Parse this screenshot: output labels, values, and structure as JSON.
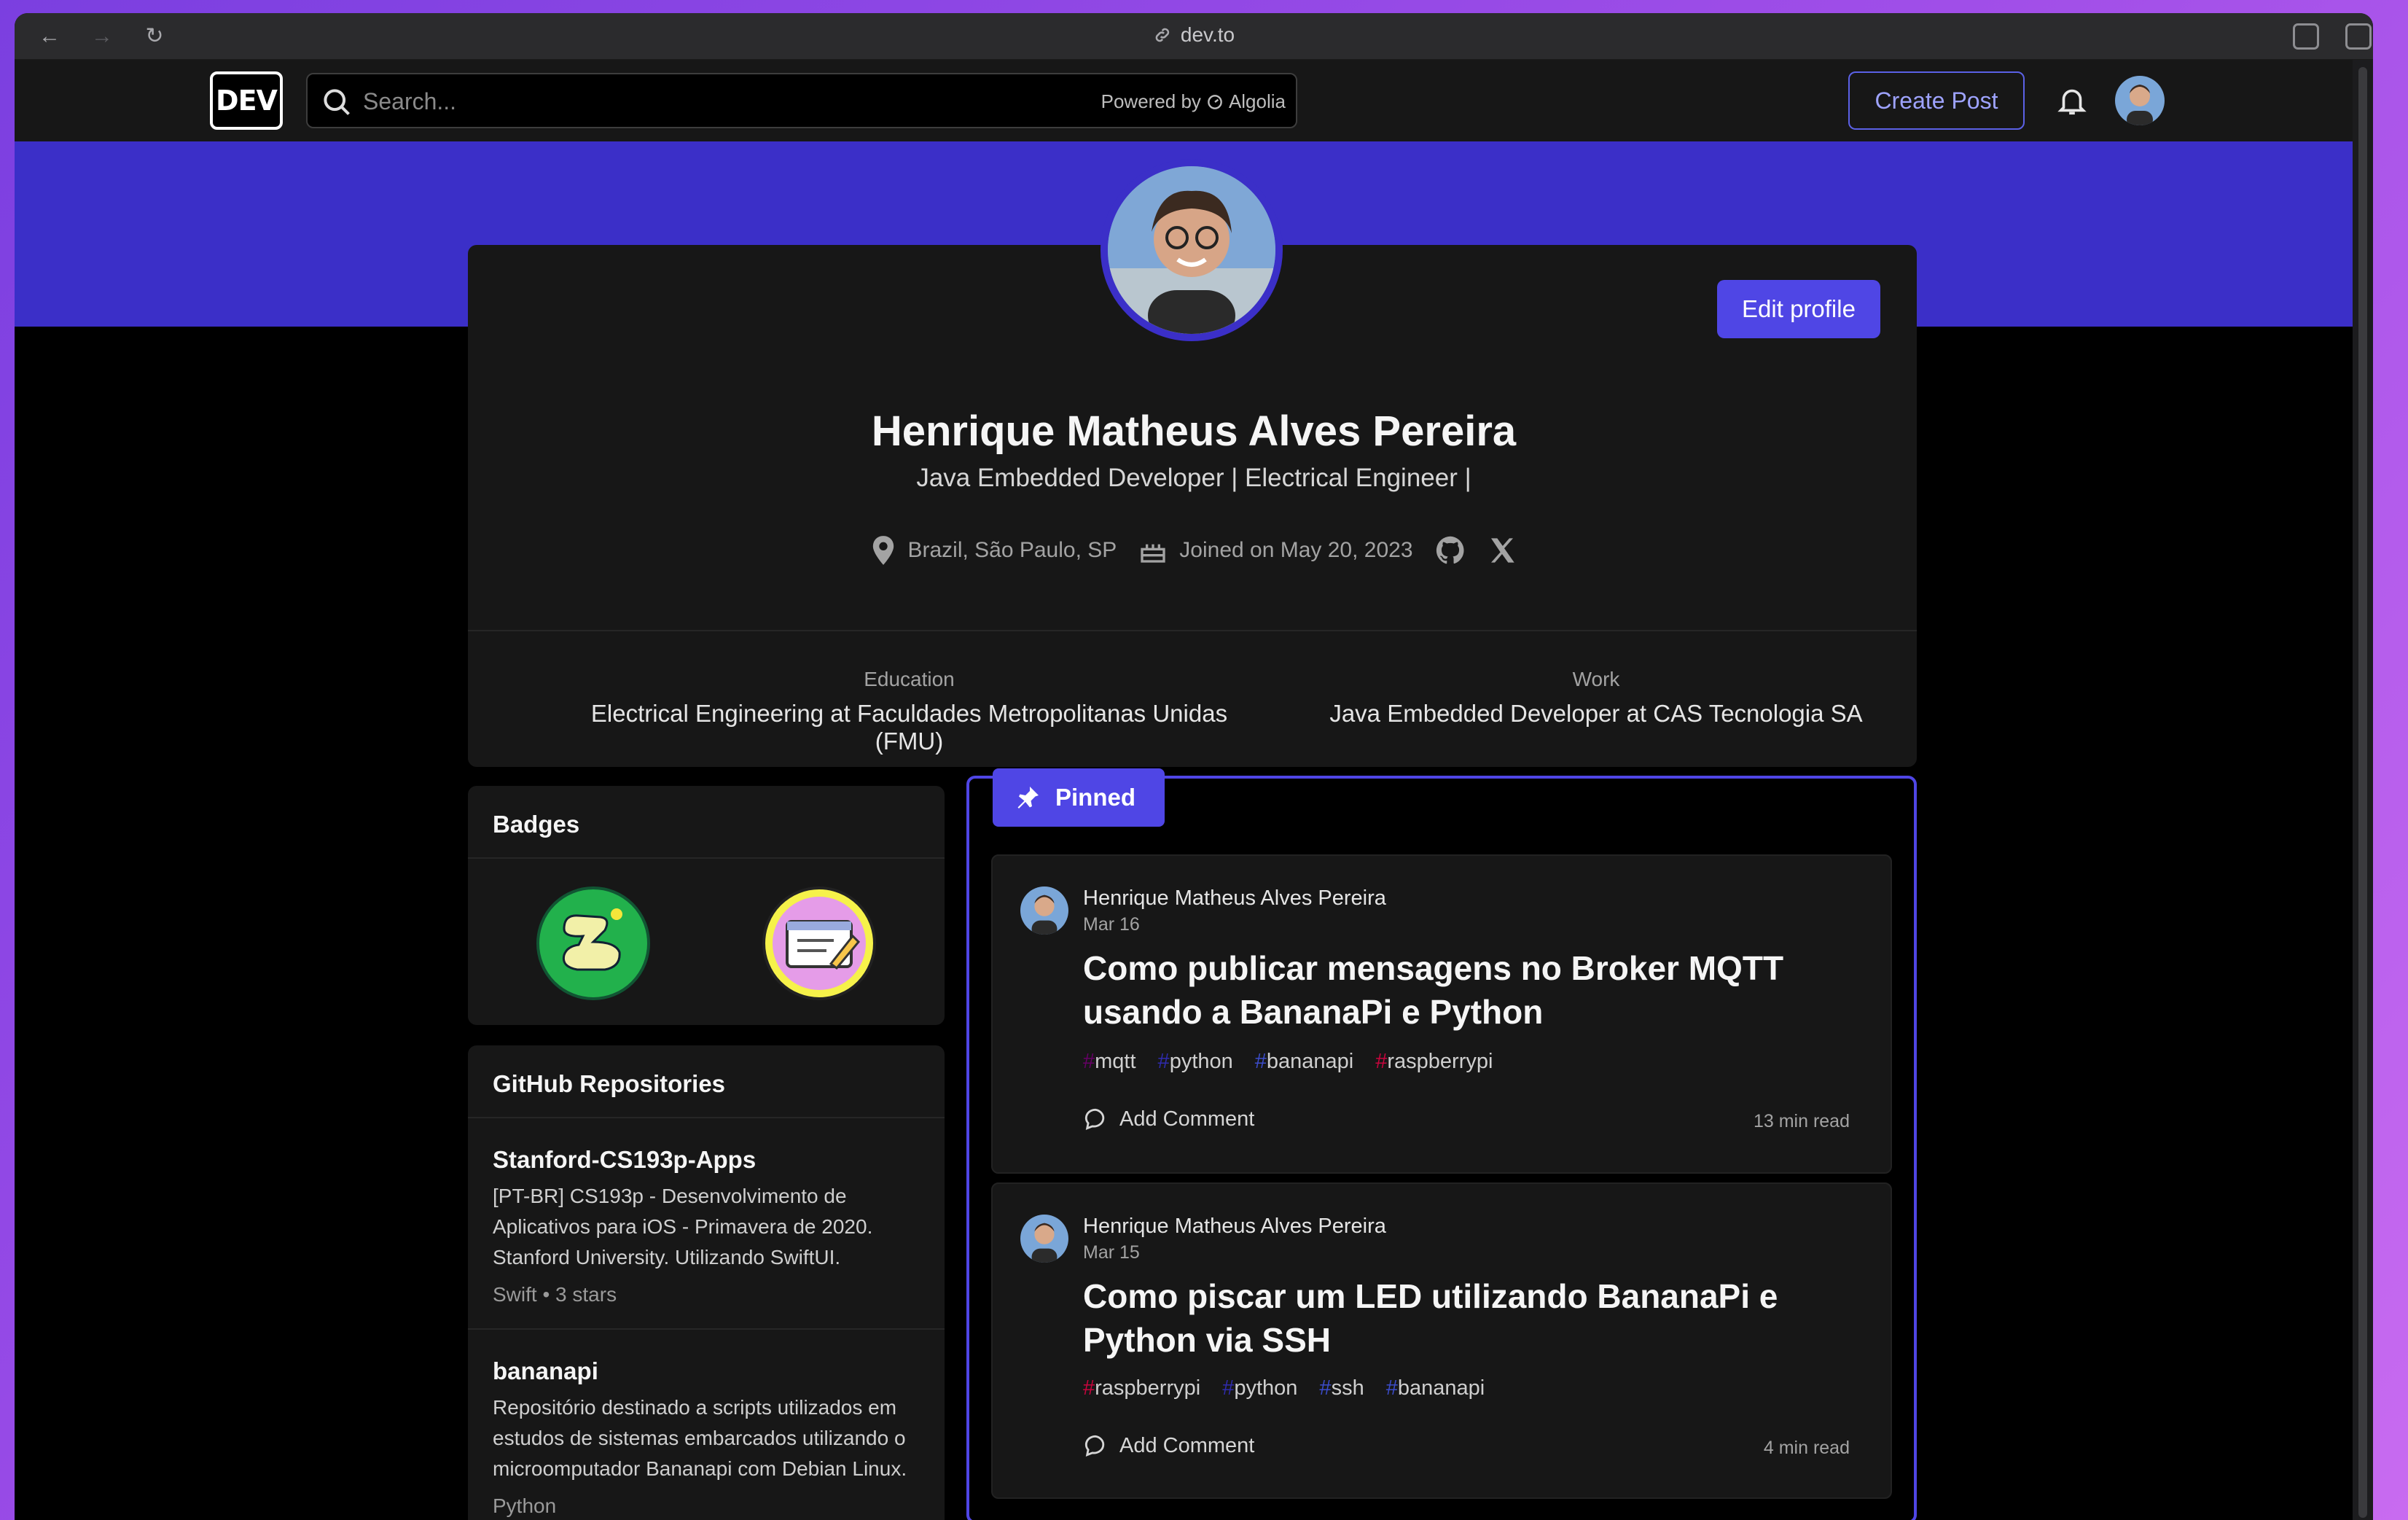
{
  "browser": {
    "url": "dev.to"
  },
  "header": {
    "logo": "DEV",
    "search_placeholder": "Search...",
    "powered_by": "Powered by",
    "algolia": "Algolia",
    "create_post": "Create Post"
  },
  "profile": {
    "edit_label": "Edit profile",
    "name": "Henrique Matheus Alves Pereira",
    "bio": "Java Embedded Developer | Electrical Engineer |",
    "location": "Brazil, São Paulo, SP",
    "joined": "Joined on May 20, 2023",
    "education_label": "Education",
    "education": "Electrical Engineering at Faculdades Metropolitanas Unidas (FMU)",
    "work_label": "Work",
    "work": "Java Embedded Developer at CAS Tecnologia SA"
  },
  "badges": {
    "title": "Badges"
  },
  "repos": {
    "title": "GitHub Repositories",
    "items": [
      {
        "name": "Stanford-CS193p-Apps",
        "desc": "[PT-BR] CS193p - Desenvolvimento de Aplicativos para iOS - Primavera de 2020. Stanford University. Utilizando SwiftUI.",
        "meta": "Swift • 3 stars"
      },
      {
        "name": "bananapi",
        "desc": "Repositório destinado a scripts utilizados em estudos de sistemas embarcados utilizando o microomputador Bananapi com Debian Linux.",
        "meta": "Python"
      }
    ]
  },
  "pinned": {
    "label": "Pinned",
    "posts": [
      {
        "author": "Henrique Matheus Alves Pereira",
        "date": "Mar 16",
        "title": "Como publicar mensagens no Broker MQTT usando a BananaPi e Python",
        "tags": [
          {
            "name": "mqtt",
            "color": "#660066"
          },
          {
            "name": "python",
            "color": "#2f2bad"
          },
          {
            "name": "bananapi",
            "color": "#3b4cca"
          },
          {
            "name": "raspberrypi",
            "color": "#c7053d"
          }
        ],
        "comment": "Add Comment",
        "read": "13 min read"
      },
      {
        "author": "Henrique Matheus Alves Pereira",
        "date": "Mar 15",
        "title": "Como piscar um LED utilizando BananaPi e Python via SSH",
        "tags": [
          {
            "name": "raspberrypi",
            "color": "#c7053d"
          },
          {
            "name": "python",
            "color": "#2f2bad"
          },
          {
            "name": "ssh",
            "color": "#3b4cca"
          },
          {
            "name": "bananapi",
            "color": "#3b4cca"
          }
        ],
        "comment": "Add Comment",
        "read": "4 min read"
      }
    ]
  }
}
